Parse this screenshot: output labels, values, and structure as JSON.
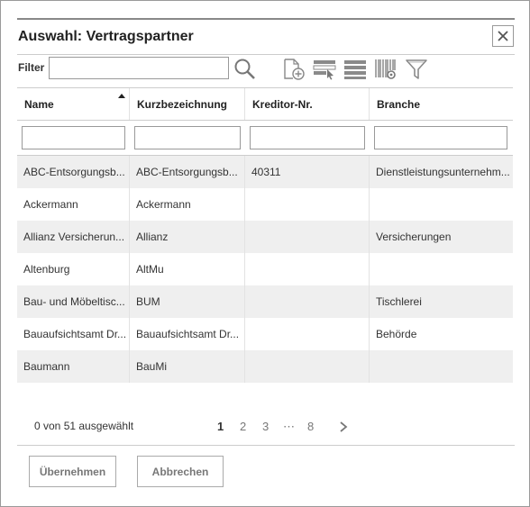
{
  "dialog": {
    "title": "Auswahl: Vertragspartner",
    "close_icon": "close-icon"
  },
  "toolbar": {
    "filter_label": "Filter",
    "filter_value": "",
    "icons": [
      "search-icon",
      "add-document-icon",
      "select-rows-icon",
      "list-view-icon",
      "barcode-settings-icon",
      "filter-icon"
    ]
  },
  "table": {
    "columns": [
      {
        "label": "Name",
        "sort": "ascending"
      },
      {
        "label": "Kurzbezeichnung"
      },
      {
        "label": "Kreditor-Nr."
      },
      {
        "label": "Branche"
      }
    ],
    "rows": [
      [
        "ABC-Entsorgungsb...",
        "ABC-Entsorgungsb...",
        "40311",
        "Dienstleistungsunternehm..."
      ],
      [
        "Ackermann",
        "Ackermann",
        "",
        ""
      ],
      [
        "Allianz Versicherun...",
        "Allianz",
        "",
        "Versicherungen"
      ],
      [
        "Altenburg",
        "AltMu",
        "",
        ""
      ],
      [
        "Bau- und Möbeltisc...",
        "BUM",
        "",
        "Tischlerei"
      ],
      [
        "Bauaufsichtsamt Dr...",
        "Bauaufsichtsamt Dr...",
        "",
        "Behörde"
      ],
      [
        "Baumann",
        "BauMi",
        "",
        ""
      ]
    ]
  },
  "footer": {
    "selection_status": "0 von 51 ausgewählt",
    "pages": [
      "1",
      "2",
      "3",
      "⋯",
      "8"
    ],
    "current_page": "1",
    "next_icon": "chevron-right-icon"
  },
  "buttons": {
    "accept": "Übernehmen",
    "cancel": "Abbrechen"
  }
}
